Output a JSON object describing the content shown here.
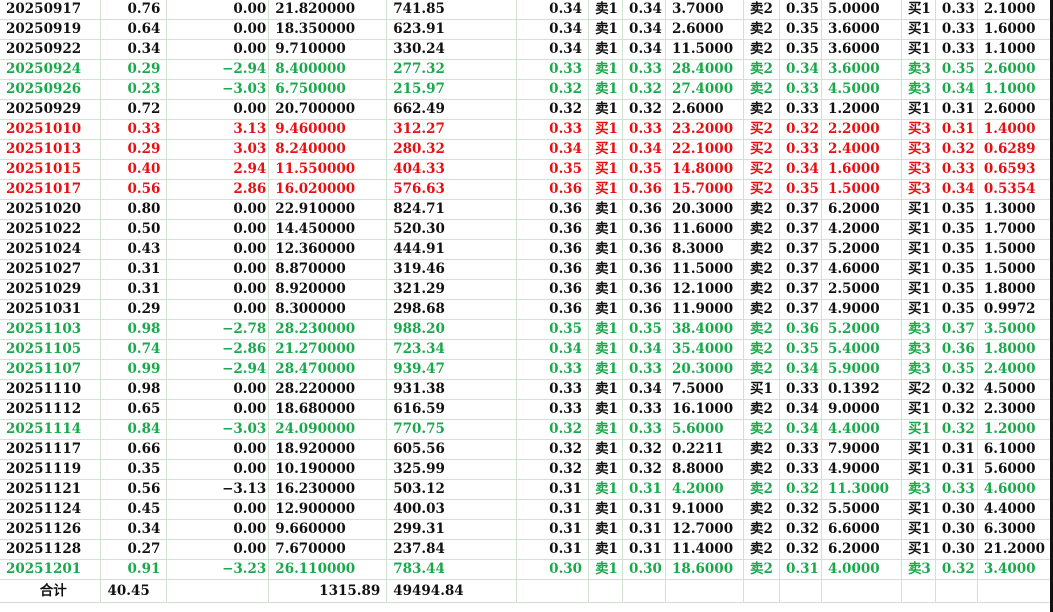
{
  "colors": {
    "green": "#1aa84b",
    "red": "#e60f12",
    "grid": "#cfe3cf",
    "text": "#111111"
  },
  "rows": [
    {
      "tone": "black",
      "c": [
        "20250917",
        "0.76",
        "0.00",
        "21.820000",
        "741.85",
        "0.34",
        "卖1",
        "0.34",
        "3.7000",
        "卖2",
        "0.35",
        "5.0000",
        "买1",
        "0.33",
        "2.1000"
      ]
    },
    {
      "tone": "black",
      "c": [
        "20250919",
        "0.64",
        "0.00",
        "18.350000",
        "623.91",
        "0.34",
        "卖1",
        "0.34",
        "2.6000",
        "卖2",
        "0.35",
        "3.6000",
        "买1",
        "0.33",
        "1.6000"
      ]
    },
    {
      "tone": "black",
      "c": [
        "20250922",
        "0.34",
        "0.00",
        "9.710000",
        "330.24",
        "0.34",
        "卖1",
        "0.34",
        "11.5000",
        "卖2",
        "0.35",
        "3.6000",
        "买1",
        "0.33",
        "1.1000"
      ]
    },
    {
      "tone": "green",
      "c": [
        "20250924",
        "0.29",
        "−2.94",
        "8.400000",
        "277.32",
        "0.33",
        "卖1",
        "0.33",
        "28.4000",
        "卖2",
        "0.34",
        "3.6000",
        "卖3",
        "0.35",
        "2.6000"
      ]
    },
    {
      "tone": "green",
      "c": [
        "20250926",
        "0.23",
        "−3.03",
        "6.750000",
        "215.97",
        "0.32",
        "卖1",
        "0.32",
        "27.4000",
        "卖2",
        "0.33",
        "4.5000",
        "卖3",
        "0.34",
        "1.1000"
      ]
    },
    {
      "tone": "black",
      "c": [
        "20250929",
        "0.72",
        "0.00",
        "20.700000",
        "662.49",
        "0.32",
        "卖1",
        "0.32",
        "2.6000",
        "卖2",
        "0.33",
        "1.2000",
        "买1",
        "0.31",
        "2.6000"
      ]
    },
    {
      "tone": "red",
      "c": [
        "20251010",
        "0.33",
        "3.13",
        "9.460000",
        "312.27",
        "0.33",
        "买1",
        "0.33",
        "23.2000",
        "买2",
        "0.32",
        "2.2000",
        "买3",
        "0.31",
        "1.4000"
      ]
    },
    {
      "tone": "red",
      "c": [
        "20251013",
        "0.29",
        "3.03",
        "8.240000",
        "280.32",
        "0.34",
        "买1",
        "0.34",
        "22.1000",
        "买2",
        "0.33",
        "2.4000",
        "买3",
        "0.32",
        "0.6289"
      ]
    },
    {
      "tone": "red",
      "c": [
        "20251015",
        "0.40",
        "2.94",
        "11.550000",
        "404.33",
        "0.35",
        "买1",
        "0.35",
        "14.8000",
        "买2",
        "0.34",
        "1.6000",
        "买3",
        "0.33",
        "0.6593"
      ]
    },
    {
      "tone": "red",
      "c": [
        "20251017",
        "0.56",
        "2.86",
        "16.020000",
        "576.63",
        "0.36",
        "买1",
        "0.36",
        "15.7000",
        "买2",
        "0.35",
        "1.5000",
        "买3",
        "0.34",
        "0.5354"
      ]
    },
    {
      "tone": "black",
      "c": [
        "20251020",
        "0.80",
        "0.00",
        "22.910000",
        "824.71",
        "0.36",
        "卖1",
        "0.36",
        "20.3000",
        "卖2",
        "0.37",
        "6.2000",
        "买1",
        "0.35",
        "1.3000"
      ]
    },
    {
      "tone": "black",
      "c": [
        "20251022",
        "0.50",
        "0.00",
        "14.450000",
        "520.30",
        "0.36",
        "卖1",
        "0.36",
        "11.6000",
        "卖2",
        "0.37",
        "4.2000",
        "买1",
        "0.35",
        "1.7000"
      ]
    },
    {
      "tone": "black",
      "c": [
        "20251024",
        "0.43",
        "0.00",
        "12.360000",
        "444.91",
        "0.36",
        "卖1",
        "0.36",
        "8.3000",
        "卖2",
        "0.37",
        "5.2000",
        "买1",
        "0.35",
        "1.5000"
      ]
    },
    {
      "tone": "black",
      "c": [
        "20251027",
        "0.31",
        "0.00",
        "8.870000",
        "319.46",
        "0.36",
        "卖1",
        "0.36",
        "11.5000",
        "卖2",
        "0.37",
        "4.6000",
        "买1",
        "0.35",
        "1.5000"
      ]
    },
    {
      "tone": "black",
      "c": [
        "20251029",
        "0.31",
        "0.00",
        "8.920000",
        "321.29",
        "0.36",
        "卖1",
        "0.36",
        "12.1000",
        "卖2",
        "0.37",
        "2.5000",
        "买1",
        "0.35",
        "1.8000"
      ]
    },
    {
      "tone": "black",
      "c": [
        "20251031",
        "0.29",
        "0.00",
        "8.300000",
        "298.68",
        "0.36",
        "卖1",
        "0.36",
        "11.9000",
        "卖2",
        "0.37",
        "4.9000",
        "买1",
        "0.35",
        "0.9972"
      ]
    },
    {
      "tone": "green",
      "c": [
        "20251103",
        "0.98",
        "−2.78",
        "28.230000",
        "988.20",
        "0.35",
        "卖1",
        "0.35",
        "38.4000",
        "卖2",
        "0.36",
        "5.2000",
        "卖3",
        "0.37",
        "3.5000"
      ]
    },
    {
      "tone": "green",
      "c": [
        "20251105",
        "0.74",
        "−2.86",
        "21.270000",
        "723.34",
        "0.34",
        "卖1",
        "0.34",
        "35.4000",
        "卖2",
        "0.35",
        "5.4000",
        "卖3",
        "0.36",
        "1.8000"
      ]
    },
    {
      "tone": "green",
      "c": [
        "20251107",
        "0.99",
        "−2.94",
        "28.470000",
        "939.47",
        "0.33",
        "卖1",
        "0.33",
        "20.3000",
        "卖2",
        "0.34",
        "5.9000",
        "卖3",
        "0.35",
        "2.4000"
      ]
    },
    {
      "tone": "black",
      "c": [
        "20251110",
        "0.98",
        "0.00",
        "28.220000",
        "931.38",
        "0.33",
        "卖1",
        "0.34",
        "7.5000",
        "买1",
        "0.33",
        "0.1392",
        "买2",
        "0.32",
        "4.5000"
      ]
    },
    {
      "tone": "black",
      "c": [
        "20251112",
        "0.65",
        "0.00",
        "18.680000",
        "616.59",
        "0.33",
        "卖1",
        "0.33",
        "16.1000",
        "卖2",
        "0.34",
        "9.0000",
        "买1",
        "0.32",
        "2.3000"
      ]
    },
    {
      "tone": "green",
      "c": [
        "20251114",
        "0.84",
        "−3.03",
        "24.090000",
        "770.75",
        "0.32",
        "卖1",
        "0.33",
        "5.6000",
        "卖2",
        "0.34",
        "4.4000",
        "买1",
        "0.32",
        "1.2000"
      ]
    },
    {
      "tone": "black",
      "c": [
        "20251117",
        "0.66",
        "0.00",
        "18.920000",
        "605.56",
        "0.32",
        "卖1",
        "0.32",
        "0.2211",
        "卖2",
        "0.33",
        "7.9000",
        "买1",
        "0.31",
        "6.1000"
      ]
    },
    {
      "tone": "black",
      "c": [
        "20251119",
        "0.35",
        "0.00",
        "10.190000",
        "325.99",
        "0.32",
        "卖1",
        "0.32",
        "8.8000",
        "卖2",
        "0.33",
        "4.9000",
        "买1",
        "0.31",
        "5.6000"
      ]
    },
    {
      "tone": "black",
      "c": [
        "20251121",
        "0.56",
        "−3.13",
        "16.230000",
        "503.12",
        "0.31",
        "卖1",
        "0.31",
        "4.2000",
        "卖2",
        "0.32",
        "11.3000",
        "卖3",
        "0.33",
        "4.6000"
      ],
      "green_from": 6
    },
    {
      "tone": "black",
      "c": [
        "20251124",
        "0.45",
        "0.00",
        "12.900000",
        "400.03",
        "0.31",
        "卖1",
        "0.31",
        "9.1000",
        "卖2",
        "0.32",
        "5.5000",
        "买1",
        "0.30",
        "4.4000"
      ]
    },
    {
      "tone": "black",
      "c": [
        "20251126",
        "0.34",
        "0.00",
        "9.660000",
        "299.31",
        "0.31",
        "卖1",
        "0.31",
        "12.7000",
        "卖2",
        "0.32",
        "6.6000",
        "买1",
        "0.30",
        "6.3000"
      ]
    },
    {
      "tone": "black",
      "c": [
        "20251128",
        "0.27",
        "0.00",
        "7.670000",
        "237.84",
        "0.31",
        "卖1",
        "0.31",
        "11.4000",
        "卖2",
        "0.32",
        "6.2000",
        "买1",
        "0.30",
        "21.2000"
      ]
    },
    {
      "tone": "green",
      "c": [
        "20251201",
        "0.91",
        "−3.23",
        "26.110000",
        "783.44",
        "0.30",
        "卖1",
        "0.30",
        "18.6000",
        "卖2",
        "0.31",
        "4.0000",
        "卖3",
        "0.32",
        "3.4000"
      ]
    }
  ],
  "total": {
    "label": "合计",
    "col2": "40.45",
    "col4": "1315.89",
    "col5": "49494.84"
  }
}
